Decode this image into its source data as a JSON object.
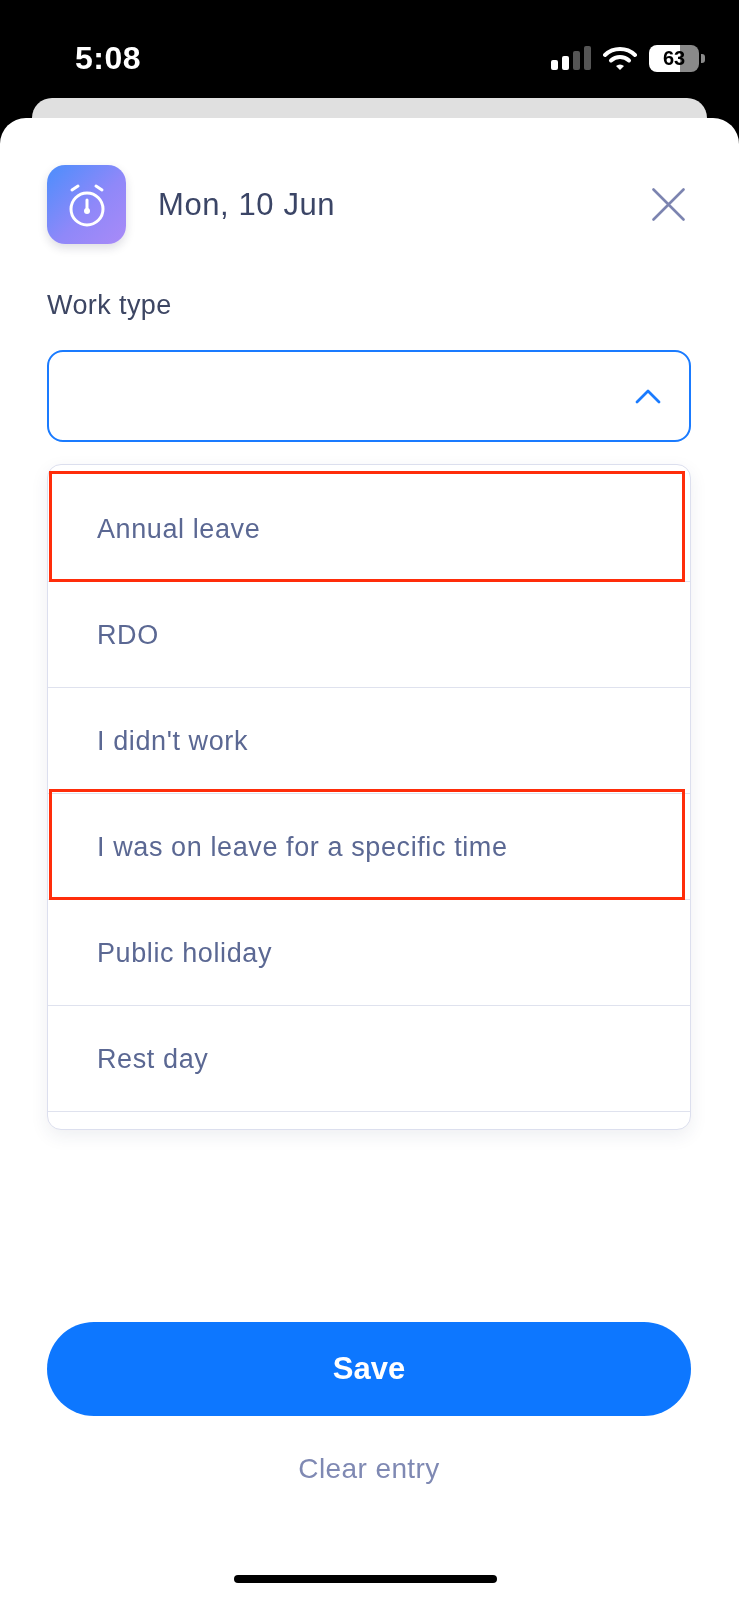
{
  "status_bar": {
    "time": "5:08",
    "battery": "63"
  },
  "header": {
    "title": "Mon, 10 Jun"
  },
  "work_type": {
    "label": "Work type",
    "expanded": true,
    "options": [
      {
        "label": "Annual leave",
        "highlighted": true
      },
      {
        "label": "RDO",
        "highlighted": false
      },
      {
        "label": "I didn't work",
        "highlighted": false
      },
      {
        "label": "I was on leave for a specific time",
        "highlighted": true
      },
      {
        "label": "Public holiday",
        "highlighted": false
      },
      {
        "label": "Rest day",
        "highlighted": false
      }
    ]
  },
  "actions": {
    "save": "Save",
    "clear": "Clear entry"
  }
}
